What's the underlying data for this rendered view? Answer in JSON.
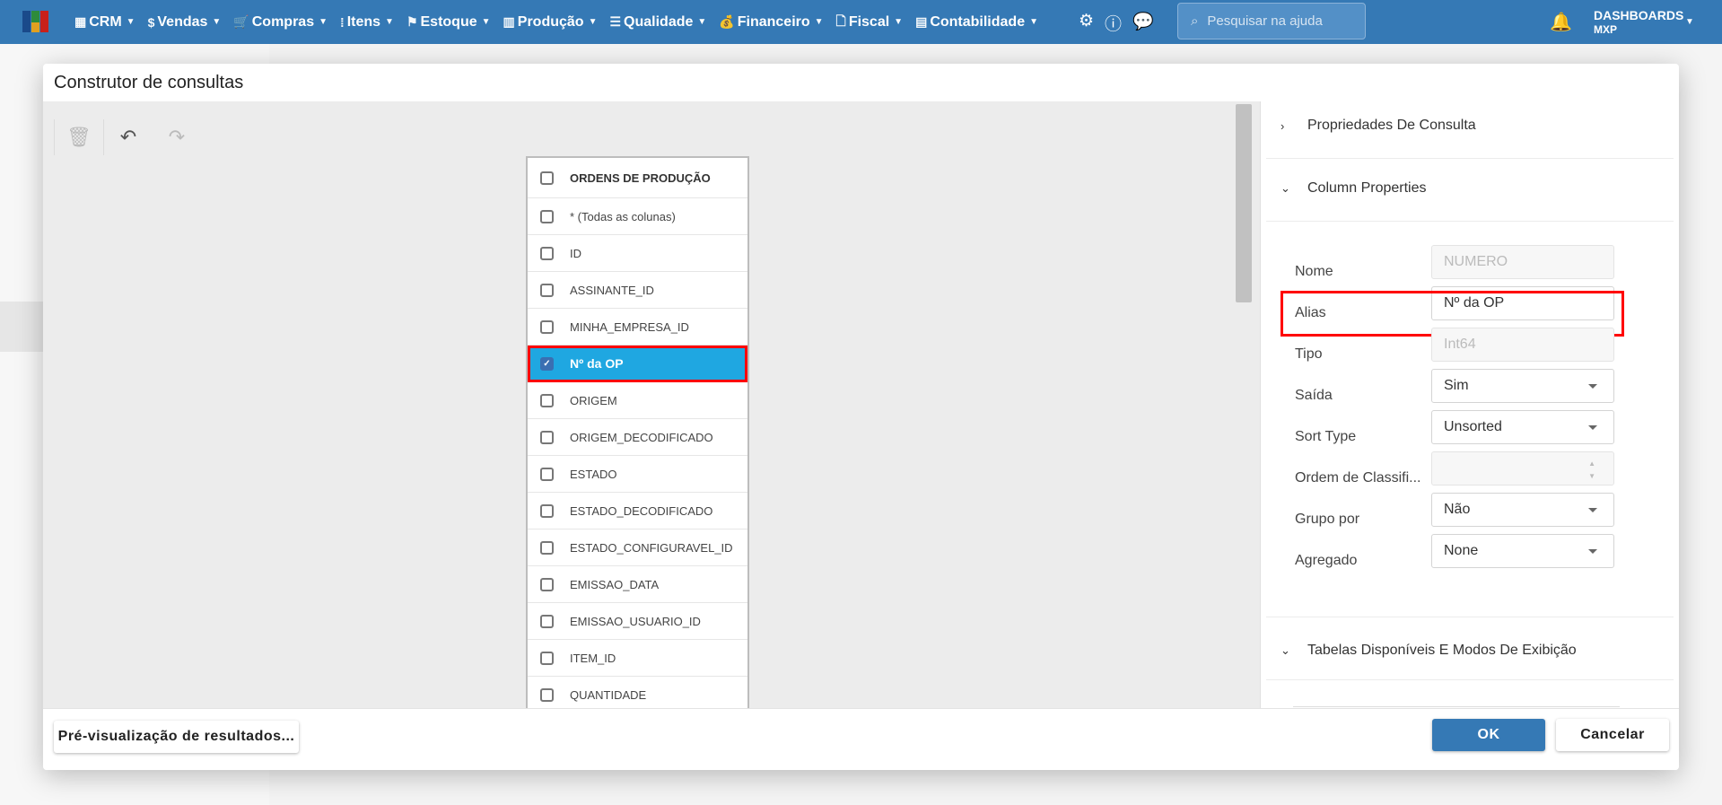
{
  "nav": {
    "logo_colors": [
      "#1a4a8a",
      "#2e8b3a",
      "#e0a020",
      "#c8201a"
    ],
    "brand_color": "#3579b5",
    "menu": [
      {
        "label": "CRM",
        "icon": "crm-icon"
      },
      {
        "label": "Vendas",
        "icon": "dollar-icon"
      },
      {
        "label": "Compras",
        "icon": "cart-icon"
      },
      {
        "label": "Itens",
        "icon": "items-icon"
      },
      {
        "label": "Estoque",
        "icon": "stock-icon"
      },
      {
        "label": "Produção",
        "icon": "factory-icon"
      },
      {
        "label": "Qualidade",
        "icon": "checklist-icon"
      },
      {
        "label": "Financeiro",
        "icon": "money-bag-icon"
      },
      {
        "label": "Fiscal",
        "icon": "document-icon"
      },
      {
        "label": "Contabilidade",
        "icon": "calculator-icon"
      }
    ],
    "search_placeholder": "Pesquisar na ajuda",
    "user_title": "DASHBOARDS",
    "user_sub": "MXP"
  },
  "modal": {
    "title": "Construtor de consultas",
    "table": {
      "title": "ORDENS DE PRODUÇÃO",
      "rows": [
        {
          "label": "* (Todas as colunas)",
          "checked": false
        },
        {
          "label": "ID",
          "checked": false
        },
        {
          "label": "ASSINANTE_ID",
          "checked": false
        },
        {
          "label": "MINHA_EMPRESA_ID",
          "checked": false
        },
        {
          "label": "Nº da OP",
          "checked": true
        },
        {
          "label": "ORIGEM",
          "checked": false
        },
        {
          "label": "ORIGEM_DECODIFICADO",
          "checked": false
        },
        {
          "label": "ESTADO",
          "checked": false
        },
        {
          "label": "ESTADO_DECODIFICADO",
          "checked": false
        },
        {
          "label": "ESTADO_CONFIGURAVEL_ID",
          "checked": false
        },
        {
          "label": "EMISSAO_DATA",
          "checked": false
        },
        {
          "label": "EMISSAO_USUARIO_ID",
          "checked": false
        },
        {
          "label": "ITEM_ID",
          "checked": false
        },
        {
          "label": "QUANTIDADE",
          "checked": false
        }
      ]
    },
    "panel": {
      "section1": "Propriedades De Consulta",
      "section2": "Column Properties",
      "section3": "Tabelas Disponíveis E Modos De Exibição",
      "fields": {
        "nome": {
          "label": "Nome",
          "value": "NUMERO"
        },
        "alias": {
          "label": "Alias",
          "value": "Nº da OP"
        },
        "tipo": {
          "label": "Tipo",
          "value": "Int64"
        },
        "saida": {
          "label": "Saída",
          "value": "Sim"
        },
        "sort": {
          "label": "Sort Type",
          "value": "Unsorted"
        },
        "ordem": {
          "label": "Ordem de Classifi...",
          "value": ""
        },
        "grupo": {
          "label": "Grupo por",
          "value": "Não"
        },
        "agregado": {
          "label": "Agregado",
          "value": "None"
        }
      }
    },
    "footer": {
      "preview": "Pré-visualização de resultados...",
      "ok": "OK",
      "cancel": "Cancelar"
    }
  }
}
